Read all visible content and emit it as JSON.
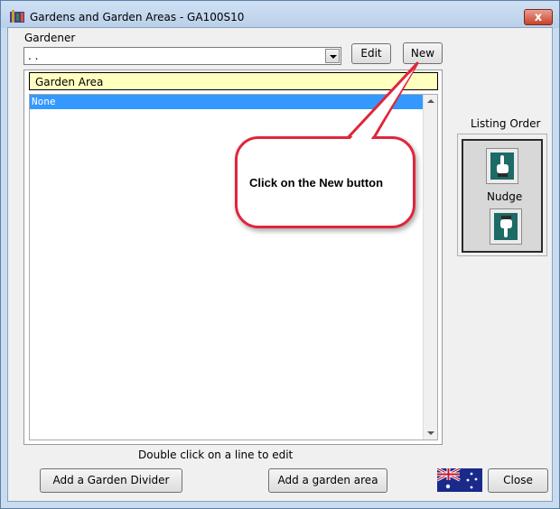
{
  "window": {
    "title": "Gardens and Garden Areas - GA100S10",
    "close_glyph": "x"
  },
  "gardener": {
    "label": "Gardener",
    "value": ". ."
  },
  "buttons": {
    "edit": "Edit",
    "new": "New",
    "add_divider": "Add a Garden Divider",
    "add_area": "Add a garden area",
    "close": "Close"
  },
  "list": {
    "column_header": "Garden Area",
    "rows": [
      {
        "text": "None",
        "selected": true
      }
    ]
  },
  "hint": "Double click on  a line to edit",
  "listing_order": {
    "label": "Listing Order",
    "nudge_label": "Nudge",
    "up_icon": "hand-pointing-up-icon",
    "down_icon": "hand-pointing-down-icon"
  },
  "callout": {
    "text": "Click on the New button",
    "border_color": "#e0263a"
  },
  "colors": {
    "header_yellow": "#ffffc0",
    "selection_blue": "#3399ff"
  }
}
